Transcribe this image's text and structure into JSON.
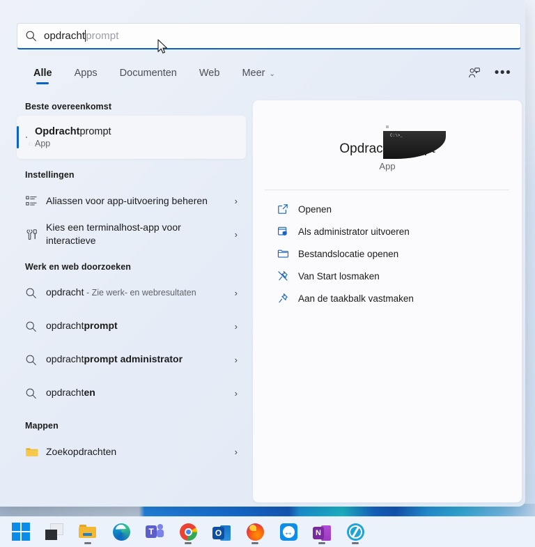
{
  "search": {
    "typed_text": "opdracht",
    "suggested_suffix": "prompt",
    "icon": "search-icon"
  },
  "tabs": [
    {
      "label": "Alle",
      "active": true
    },
    {
      "label": "Apps",
      "active": false
    },
    {
      "label": "Documenten",
      "active": false
    },
    {
      "label": "Web",
      "active": false
    },
    {
      "label": "Meer",
      "active": false,
      "chevron": "⌄"
    }
  ],
  "top_right": {
    "feedback_icon": "feedback-icon",
    "more_options": "•••"
  },
  "results": {
    "best_match": {
      "heading": "Beste overeenkomst",
      "title_bold": "Opdracht",
      "title_rest": "prompt",
      "subtitle": "App",
      "icon": "command-prompt-icon"
    },
    "settings": {
      "heading": "Instellingen",
      "items": [
        {
          "label": "Aliassen voor app-uitvoering beheren",
          "icon": "list-settings-icon",
          "chevron": "›"
        },
        {
          "label": "Kies een terminalhost-app voor interactieve",
          "icon": "tools-icon",
          "chevron": "›"
        }
      ]
    },
    "web": {
      "heading": "Werk en web doorzoeken",
      "items": [
        {
          "prefix": "opdracht",
          "bold": "",
          "muted": " - Zie werk- en webresultaten",
          "icon": "search-icon",
          "chevron": "›"
        },
        {
          "prefix": "opdracht",
          "bold": "prompt",
          "muted": "",
          "icon": "search-icon",
          "chevron": "›"
        },
        {
          "prefix": "opdracht",
          "bold": "prompt administrator",
          "muted": "",
          "icon": "search-icon",
          "chevron": "›"
        },
        {
          "prefix": "opdracht",
          "bold": "en",
          "muted": "",
          "icon": "search-icon",
          "chevron": "›"
        }
      ]
    },
    "folders": {
      "heading": "Mappen",
      "items": [
        {
          "label": "Zoekopdrachten",
          "icon": "folder-icon",
          "chevron": "›"
        }
      ]
    }
  },
  "preview": {
    "icon": "command-prompt-icon",
    "title": "Opdrachtprompt",
    "subtitle": "App",
    "actions": [
      {
        "label": "Openen",
        "icon": "open-external-icon"
      },
      {
        "label": "Als administrator uitvoeren",
        "icon": "shield-admin-icon"
      },
      {
        "label": "Bestandslocatie openen",
        "icon": "folder-open-icon"
      },
      {
        "label": "Van Start losmaken",
        "icon": "unpin-icon"
      },
      {
        "label": "Aan de taakbalk vastmaken",
        "icon": "pin-icon"
      }
    ]
  },
  "taskbar": {
    "items": [
      {
        "name": "start-button",
        "icon": "windows-logo-icon",
        "running": false
      },
      {
        "name": "task-view-button",
        "icon": "task-view-icon",
        "running": false
      },
      {
        "name": "file-explorer-button",
        "icon": "file-explorer-icon",
        "running": true
      },
      {
        "name": "edge-button",
        "icon": "edge-icon",
        "running": false
      },
      {
        "name": "teams-button",
        "icon": "teams-icon",
        "running": false
      },
      {
        "name": "chrome-button",
        "icon": "chrome-icon",
        "running": true
      },
      {
        "name": "outlook-button",
        "icon": "outlook-icon",
        "running": false
      },
      {
        "name": "firefox-button",
        "icon": "firefox-icon",
        "running": true
      },
      {
        "name": "teamviewer-button",
        "icon": "teamviewer-icon",
        "running": false
      },
      {
        "name": "onenote-button",
        "icon": "onenote-icon",
        "running": true
      },
      {
        "name": "network-app-button",
        "icon": "globe-icon",
        "running": true
      }
    ]
  },
  "colors": {
    "accent": "#0b62c4",
    "panel_bg": "#e9eef7",
    "preview_bg": "#fbfbfd",
    "text": "#1b1b1b",
    "muted_text": "#5f6368"
  }
}
